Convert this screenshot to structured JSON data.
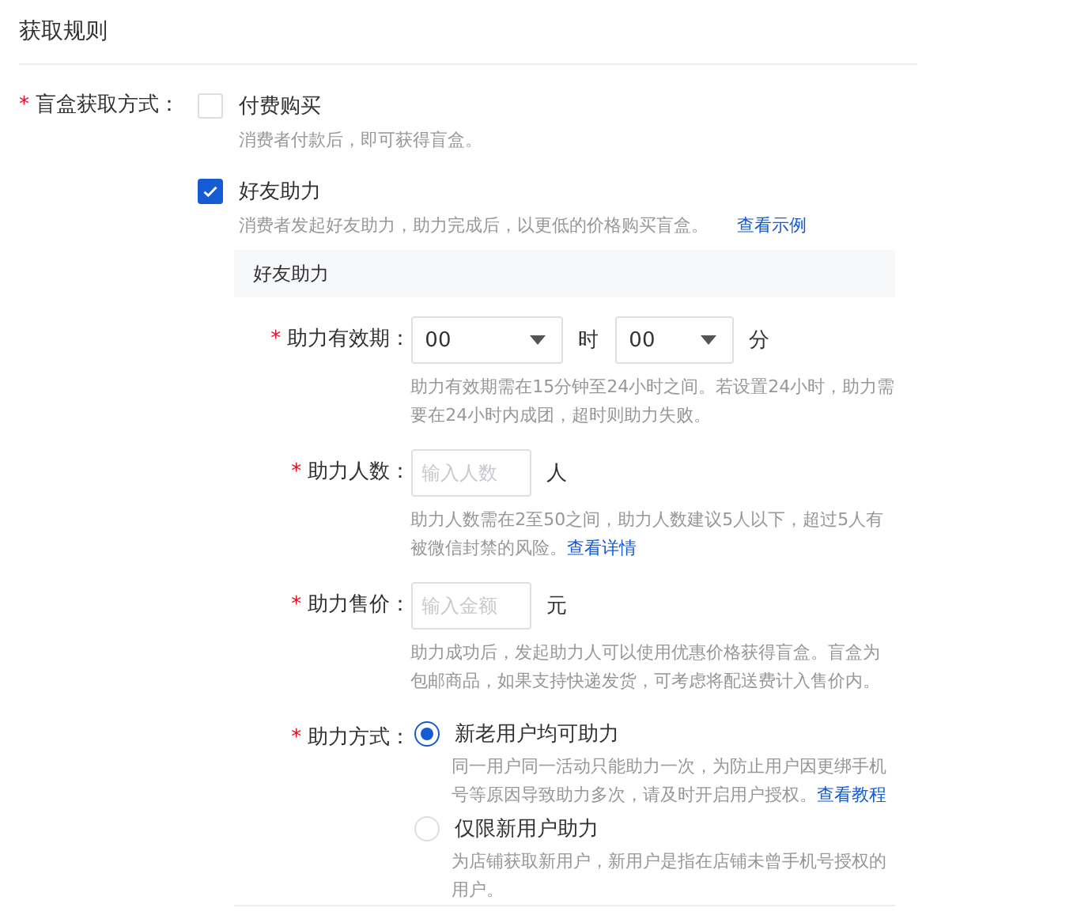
{
  "section_title": "获取规则",
  "method": {
    "label": "盲盒获取方式：",
    "required_mark": "*",
    "options": [
      {
        "label": "付费购买",
        "checked": false,
        "hint": "消费者付款后，即可获得盲盒。"
      },
      {
        "label": "好友助力",
        "checked": true,
        "hint": "消费者发起好友助力，助力完成后，以更低的价格购买盲盒。",
        "link": "查看示例"
      }
    ]
  },
  "subsection": {
    "title": "好友助力",
    "fields": [
      {
        "kind": "time",
        "label": "助力有效期：",
        "required_mark": "*",
        "selects": [
          {
            "value": "00",
            "unit": "时"
          },
          {
            "value": "00",
            "unit": "分"
          }
        ],
        "hint": "助力有效期需在15分钟至24小时之间。若设置24小时，助力需要在24小时内成团，超时则助力失败。"
      },
      {
        "kind": "input",
        "label": "助力人数：",
        "required_mark": "*",
        "placeholder": "输入人数",
        "unit": "人",
        "hint": "助力人数需在2至50之间，助力人数建议5人以下，超过5人有被微信封禁的风险。",
        "link": "查看详情"
      },
      {
        "kind": "input",
        "label": "助力售价：",
        "required_mark": "*",
        "placeholder": "输入金额",
        "unit": "元",
        "hint": "助力成功后，发起助力人可以使用优惠价格获得盲盒。盲盒为包邮商品，如果支持快递发货，可考虑将配送费计入售价内。"
      },
      {
        "kind": "radio",
        "label": "助力方式：",
        "required_mark": "*",
        "options": [
          {
            "label": "新老用户均可助力",
            "selected": true,
            "hint": "同一用户同一活动只能助力一次，为防止用户因更绑手机号等原因导致助力多次，请及时开启用户授权。",
            "link": "查看教程"
          },
          {
            "label": "仅限新用户助力",
            "selected": false,
            "hint": "为店铺获取新用户，新用户是指在店铺未曾手机号授权的用户。"
          }
        ]
      }
    ]
  }
}
